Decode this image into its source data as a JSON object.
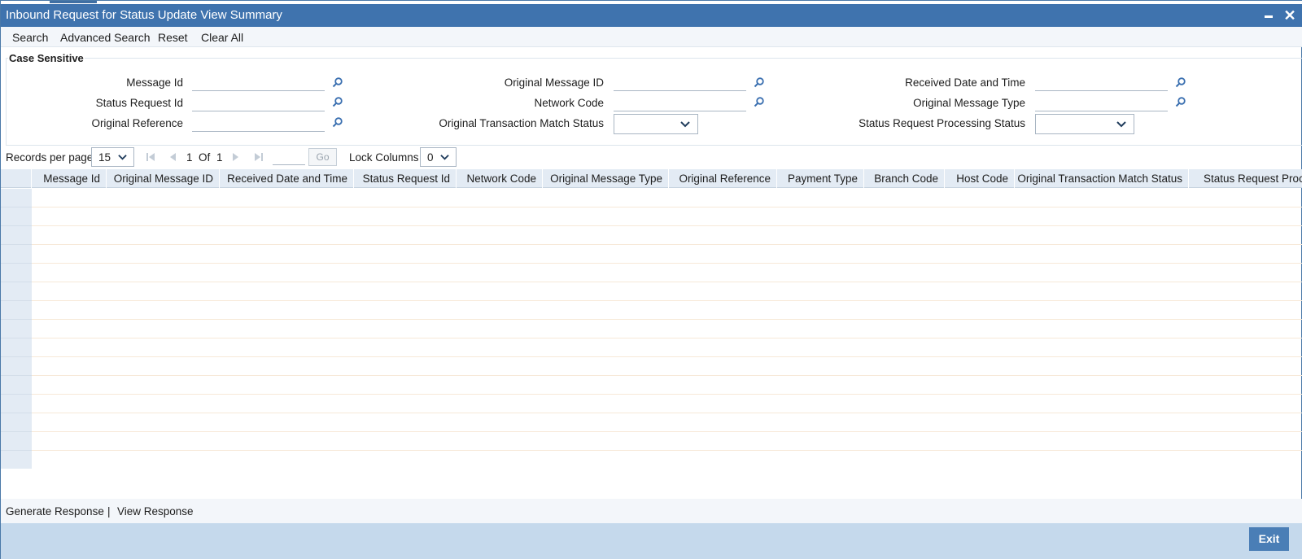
{
  "window": {
    "title": "Inbound Request for Status Update View Summary",
    "minimize_icon": "minimize-icon",
    "close_icon": "close-icon"
  },
  "toolbar": {
    "search": "Search",
    "advanced_search": "Advanced Search",
    "reset": "Reset",
    "clear_all": "Clear All"
  },
  "criteria": {
    "legend": "Case Sensitive",
    "message_id": {
      "label": "Message Id",
      "value": ""
    },
    "status_request_id": {
      "label": "Status Request Id",
      "value": ""
    },
    "original_reference": {
      "label": "Original Reference",
      "value": ""
    },
    "original_message_id": {
      "label": "Original Message ID",
      "value": ""
    },
    "network_code": {
      "label": "Network Code",
      "value": ""
    },
    "original_transaction_match_status": {
      "label": "Original Transaction Match Status",
      "selected": ""
    },
    "received_date_time": {
      "label": "Received Date and Time",
      "value": ""
    },
    "original_message_type": {
      "label": "Original Message Type",
      "value": ""
    },
    "status_request_processing_status": {
      "label": "Status Request Processing Status",
      "selected": ""
    }
  },
  "pager": {
    "records_per_page_label": "Records per page",
    "records_per_page": "15",
    "current_page": "1",
    "of_label": "Of",
    "total_pages": "1",
    "go_label": "Go",
    "lock_columns_label": "Lock Columns",
    "lock_columns": "0"
  },
  "grid": {
    "columns": [
      "Message Id",
      "Original Message ID",
      "Received Date and Time",
      "Status Request Id",
      "Network Code",
      "Original Message Type",
      "Original Reference",
      "Payment Type",
      "Branch Code",
      "Host Code",
      "Original Transaction Match Status",
      "Status Request Proc"
    ],
    "row_count": 15
  },
  "footer": {
    "generate_response": "Generate Response",
    "separator": "|",
    "view_response": "View Response",
    "exit": "Exit"
  },
  "colors": {
    "title_bar": "#3f73ae",
    "header_bg": "#e3ebf4",
    "footer_bar": "#c5d9ec",
    "exit_button": "#4a7eb6",
    "icon_blue": "#3a6fb0"
  }
}
